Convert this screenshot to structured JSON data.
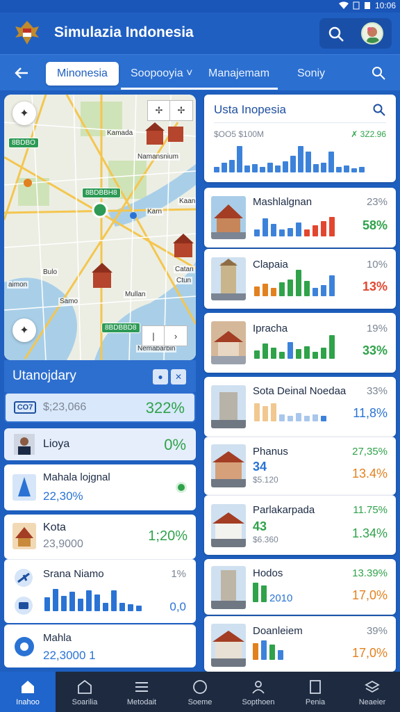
{
  "status": {
    "time": "10:06"
  },
  "app": {
    "title": "Simulazia Indonesia"
  },
  "tabs": [
    {
      "label": "Minonesia"
    },
    {
      "label": "Soopooyia ˅"
    },
    {
      "label": "Manajemam"
    },
    {
      "label": "Soniy"
    }
  ],
  "map": {
    "labels": [
      "Kamada",
      "Namansnium",
      "Kaan",
      "Karn",
      "Mullan",
      "Catan",
      "Samo",
      "aimon",
      "Bulo",
      "Ctun",
      "Nemabarbin"
    ],
    "tags": [
      "8BDBO",
      "8BDBBH8",
      "8BDBBD8"
    ]
  },
  "left_panel": {
    "title": "Utanojdary",
    "rows": [
      {
        "badge": "CO7",
        "value": "$;23,066",
        "pct": "322%"
      },
      {
        "name": "Lioya",
        "pct": "0%"
      },
      {
        "name": "Mahala lojgnal",
        "value": "22,30%"
      },
      {
        "name": "Kota",
        "value": "23,9000",
        "pct": "1;20%"
      },
      {
        "name": "Srana Niamo",
        "pct_top": "1%",
        "pct_bottom": "0,0"
      },
      {
        "name": "Mahla",
        "value": "22,3000 1"
      }
    ]
  },
  "right_panel": {
    "header": {
      "title": "Usta Inopesia",
      "left_caption": "$OO5 $100M",
      "right_caption": "✗ 3Z2.96"
    },
    "cards": [
      {
        "name": "Mashlalgnan",
        "pct_top": "23%",
        "pct_big": "58%",
        "big_color": "#2fa24a"
      },
      {
        "name": "Clapaia",
        "pct_top": "10%",
        "pct_big": "13%",
        "big_color": "#e2462f"
      },
      {
        "name": "Ipracha",
        "pct_top": "19%",
        "pct_big": "33%",
        "big_color": "#2fa24a"
      },
      {
        "name": "Sota Deinal Noedaa",
        "pct_top": "33%",
        "pct_big": "11,8%",
        "big_color": "#2a73d4"
      },
      {
        "name": "Phanus",
        "sub_value": "34",
        "sub_small": "$5.120",
        "pct_top": "27,35%",
        "pct_big": "13.4%",
        "big_color": "#e2811f"
      },
      {
        "name": "Parlakarpada",
        "sub_value": "43",
        "sub_small": "$6.360",
        "pct_top": "11.75%",
        "pct_big": "1.34%",
        "big_color": "#2fa24a"
      },
      {
        "name": "Hodos",
        "sub_value": "2010",
        "pct_top": "13.39%",
        "pct_big": "17,0%",
        "big_color": "#e2811f"
      },
      {
        "name": "Doanleiem",
        "pct_top": "39%",
        "pct_big": "17,0%",
        "big_color": "#e2811f"
      }
    ]
  },
  "nav": [
    {
      "label": "Inahoo",
      "icon": "home-icon"
    },
    {
      "label": "Soarilia",
      "icon": "building-icon"
    },
    {
      "label": "Metodait",
      "icon": "menu-icon"
    },
    {
      "label": "Soeme",
      "icon": "circle-icon"
    },
    {
      "label": "Sopthoen",
      "icon": "people-icon"
    },
    {
      "label": "Penia",
      "icon": "document-icon"
    },
    {
      "label": "Neaeier",
      "icon": "stack-icon"
    }
  ],
  "colors": {
    "primary": "#1f5fc1",
    "green": "#2fa24a",
    "red": "#e2462f",
    "orange": "#e2811f",
    "blue": "#2a73d4"
  }
}
